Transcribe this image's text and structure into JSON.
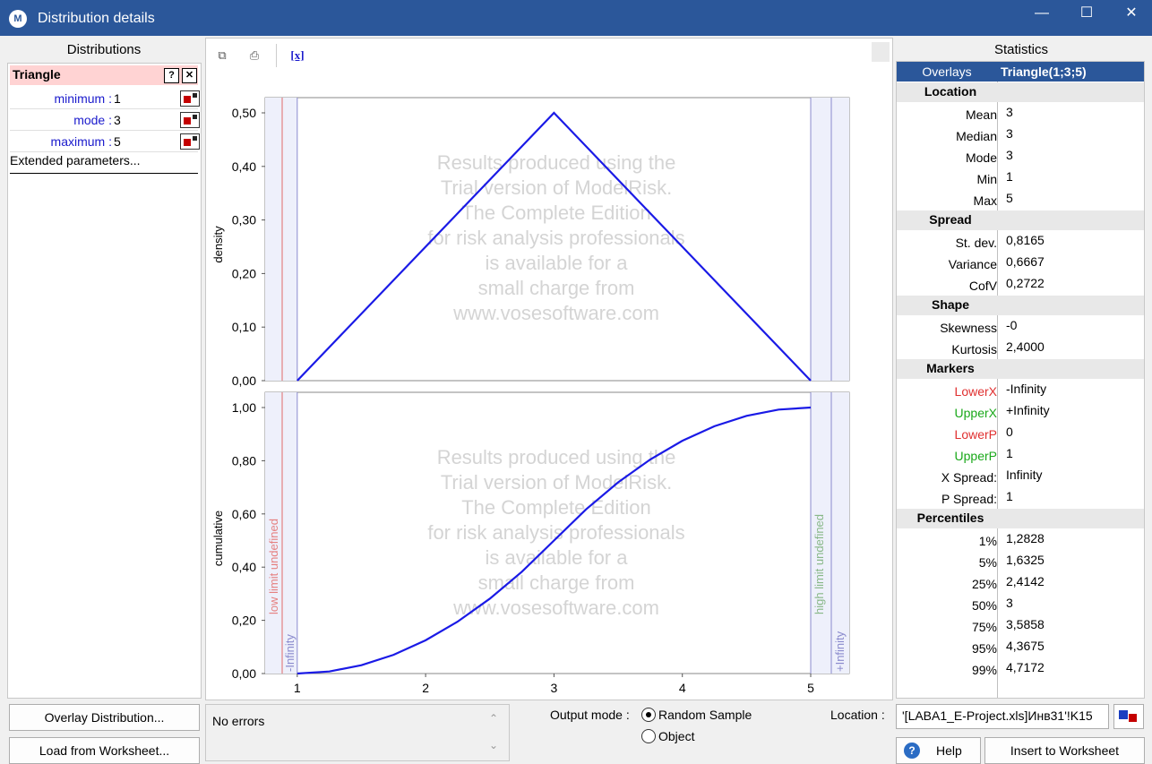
{
  "window": {
    "title": "Distribution details",
    "app_icon": "modelrisk-icon"
  },
  "distributions": {
    "header": "Distributions",
    "name": "Triangle",
    "help_label": "?",
    "close_label": "✕",
    "params": [
      {
        "name": "minimum :",
        "value": "1"
      },
      {
        "name": "mode :",
        "value": "3"
      },
      {
        "name": "maximum :",
        "value": "5"
      }
    ],
    "extended_label": "Extended parameters..."
  },
  "chart": {
    "watermark": [
      "Results produced using the",
      "Trial version of ModelRisk.",
      "The Complete Edition",
      "for risk analysis professionals",
      "is available for a",
      "small charge from",
      "www.vosesoftware.com"
    ],
    "toolbar": {
      "fx_label": "[x]"
    },
    "low_note": "low limit undefined",
    "high_note": "high limit undefined",
    "low_inf": "-Infinity",
    "high_inf": "+Infinity"
  },
  "chart_data": [
    {
      "type": "line",
      "ylabel": "density",
      "x": [
        1,
        3,
        5
      ],
      "series": [
        {
          "values": [
            0,
            0.5,
            0
          ]
        }
      ],
      "xlim": [
        0.75,
        5.3
      ],
      "ylim": [
        0,
        0.5
      ],
      "yticks": [
        "0,00",
        "0,10",
        "0,20",
        "0,30",
        "0,40",
        "0,50"
      ],
      "color": "#1a1ae6"
    },
    {
      "type": "line",
      "ylabel": "cumulative",
      "x": [
        1,
        1.25,
        1.5,
        1.75,
        2,
        2.25,
        2.5,
        2.75,
        3,
        3.25,
        3.5,
        3.75,
        4,
        4.25,
        4.5,
        4.75,
        5
      ],
      "series": [
        {
          "values": [
            0,
            0.0078,
            0.0313,
            0.0703,
            0.125,
            0.1953,
            0.2813,
            0.3828,
            0.5,
            0.6172,
            0.7188,
            0.8047,
            0.875,
            0.9297,
            0.9688,
            0.9922,
            1
          ]
        }
      ],
      "xlim": [
        0.75,
        5.3
      ],
      "ylim": [
        0,
        1
      ],
      "xticks": [
        "1",
        "2",
        "3",
        "4",
        "5"
      ],
      "yticks": [
        "0,00",
        "0,20",
        "0,40",
        "0,60",
        "0,80",
        "1,00"
      ],
      "color": "#1a1ae6"
    }
  ],
  "statistics": {
    "header": "Statistics",
    "overlays_label": "Overlays",
    "overlays_value": "Triangle(1;3;5)",
    "sections": [
      {
        "title": "Location",
        "rows": [
          {
            "label": "Mean",
            "value": "3"
          },
          {
            "label": "Median",
            "value": "3"
          },
          {
            "label": "Mode",
            "value": "3"
          },
          {
            "label": "Min",
            "value": "1"
          },
          {
            "label": "Max",
            "value": "5"
          }
        ]
      },
      {
        "title": "Spread",
        "rows": [
          {
            "label": "St. dev.",
            "value": "0,8165"
          },
          {
            "label": "Variance",
            "value": "0,6667"
          },
          {
            "label": "CofV",
            "value": "0,2722"
          }
        ]
      },
      {
        "title": "Shape",
        "rows": [
          {
            "label": "Skewness",
            "value": "-0"
          },
          {
            "label": "Kurtosis",
            "value": "2,4000"
          }
        ]
      },
      {
        "title": "Markers",
        "rows": [
          {
            "label": "LowerX",
            "value": "-Infinity",
            "color": "#e03030"
          },
          {
            "label": "UpperX",
            "value": "+Infinity",
            "color": "#1aa81a"
          },
          {
            "label": "LowerP",
            "value": "0",
            "color": "#e03030"
          },
          {
            "label": "UpperP",
            "value": "1",
            "color": "#1aa81a"
          },
          {
            "label": "X Spread:",
            "value": "Infinity"
          },
          {
            "label": "P Spread:",
            "value": "1"
          }
        ]
      },
      {
        "title": "Percentiles",
        "rows": [
          {
            "label": "1%",
            "value": "1,2828"
          },
          {
            "label": "5%",
            "value": "1,6325"
          },
          {
            "label": "25%",
            "value": "2,4142"
          },
          {
            "label": "50%",
            "value": "3"
          },
          {
            "label": "75%",
            "value": "3,5858"
          },
          {
            "label": "95%",
            "value": "4,3675"
          },
          {
            "label": "99%",
            "value": "4,7172"
          }
        ]
      }
    ]
  },
  "bottom": {
    "overlay_btn": "Overlay Distribution...",
    "load_btn": "Load from Worksheet...",
    "errors_text": "No errors",
    "output_mode_label": "Output mode :",
    "random_sample_label": "Random Sample",
    "object_label": "Object",
    "location_label": "Location :",
    "location_value": "'[LABA1_E-Project.xls]Инв31'!K15",
    "help_btn": "Help",
    "insert_btn": "Insert to Worksheet"
  }
}
